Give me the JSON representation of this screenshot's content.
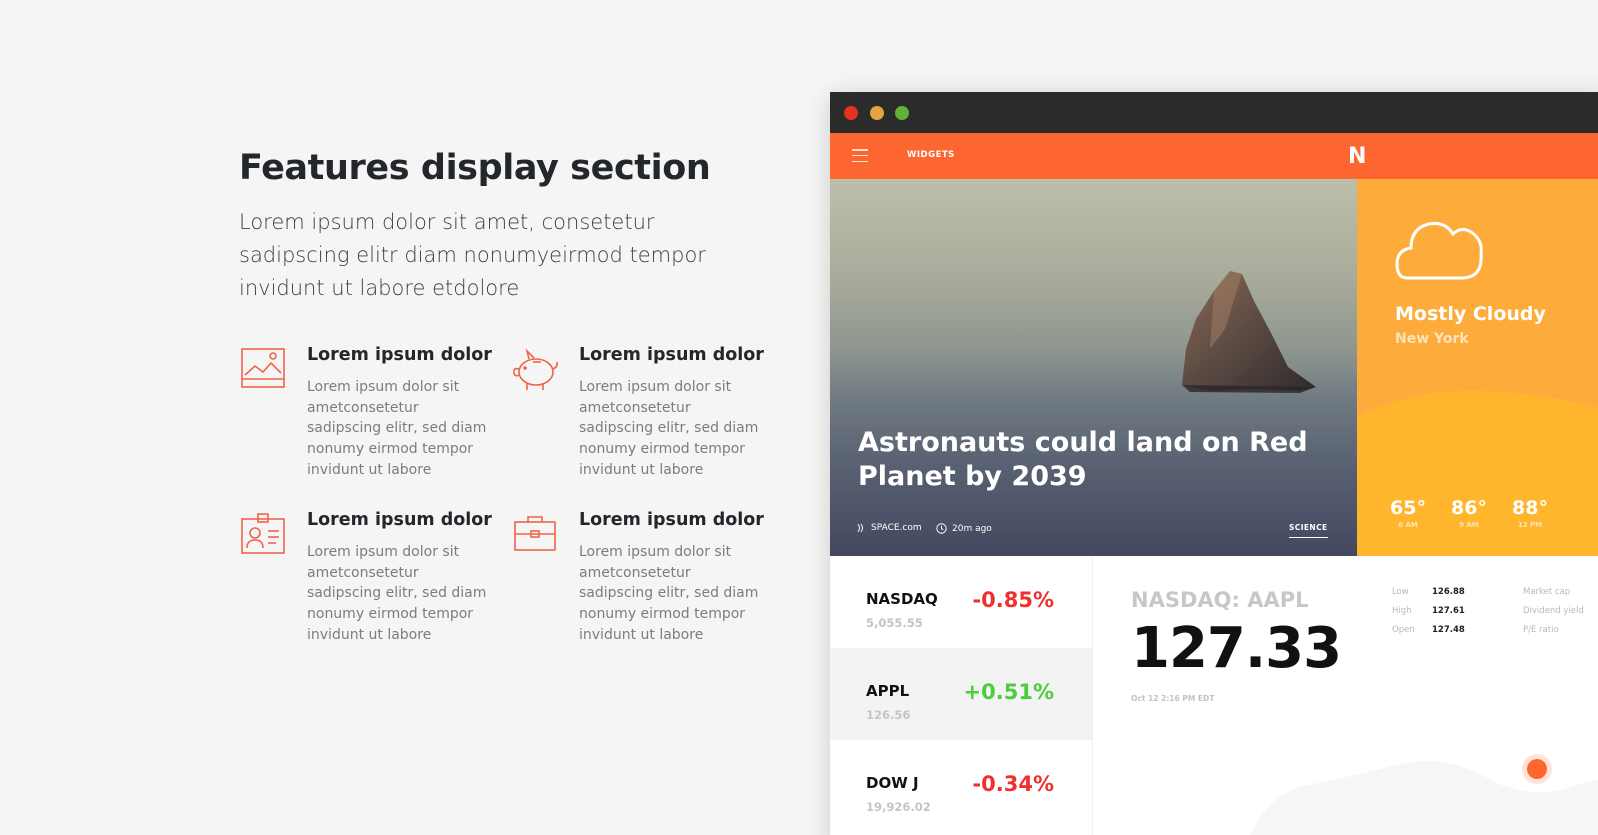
{
  "heading": "Features display section",
  "lead": "Lorem ipsum dolor sit amet, consetetur sadipscing elitr diam nonumyeirmod tempor invidunt ut labore etdolore",
  "features": [
    {
      "icon": "image-icon",
      "title": "Lorem ipsum dolor",
      "desc": "Lorem ipsum dolor sit ametconsetetur sadipscing elitr, sed diam nonumy eirmod tempor invidunt ut labore"
    },
    {
      "icon": "piggy-bank-icon",
      "title": "Lorem ipsum dolor",
      "desc": "Lorem ipsum dolor sit ametconsetetur sadipscing elitr, sed diam nonumy eirmod tempor invidunt ut labore"
    },
    {
      "icon": "id-card-icon",
      "title": "Lorem ipsum dolor",
      "desc": "Lorem ipsum dolor sit ametconsetetur sadipscing elitr, sed diam nonumy eirmod tempor invidunt ut labore"
    },
    {
      "icon": "briefcase-icon",
      "title": "Lorem ipsum dolor",
      "desc": "Lorem ipsum dolor sit ametconsetetur sadipscing elitr, sed diam nonumy eirmod tempor invidunt ut labore"
    }
  ],
  "colors": {
    "accent": "#fe6631",
    "weather": "#fdac3b",
    "positive": "#4ccd3a",
    "negative": "#f0302d",
    "window_close": "#e1331f",
    "window_min": "#e3a43d",
    "window_max": "#5fb235"
  },
  "app": {
    "menu_label": "WIDGETS",
    "logo": "N",
    "hero": {
      "title": "Astronauts could land on Red Planet by 2039",
      "source": "SPACE.com",
      "time": "20m ago",
      "tag": "SCIENCE"
    },
    "weather": {
      "icon": "cloud-icon",
      "condition": "Mostly Cloudy",
      "city": "New York",
      "temps": [
        {
          "value": "65°",
          "time": "6 AM"
        },
        {
          "value": "86°",
          "time": "9 AM"
        },
        {
          "value": "88°",
          "time": "12 PM"
        }
      ]
    },
    "stocks": [
      {
        "name": "NASDAQ",
        "value": "5,055.55",
        "change": "-0.85%",
        "direction": "down"
      },
      {
        "name": "APPL",
        "value": "126.56",
        "change": "+0.51%",
        "direction": "up"
      },
      {
        "name": "DOW J",
        "value": "19,926.02",
        "change": "-0.34%",
        "direction": "down"
      }
    ],
    "detail": {
      "symbol": "NASDAQ: AAPL",
      "price": "127.33",
      "timestamp": "Oct 12 2:16 PM EDT",
      "stats": [
        {
          "label": "Low",
          "value": "126.88"
        },
        {
          "label": "High",
          "value": "127.61"
        },
        {
          "label": "Open",
          "value": "127.48"
        }
      ],
      "stats2": [
        "Market cap",
        "Dividend yield",
        "P/E ratio"
      ]
    }
  }
}
